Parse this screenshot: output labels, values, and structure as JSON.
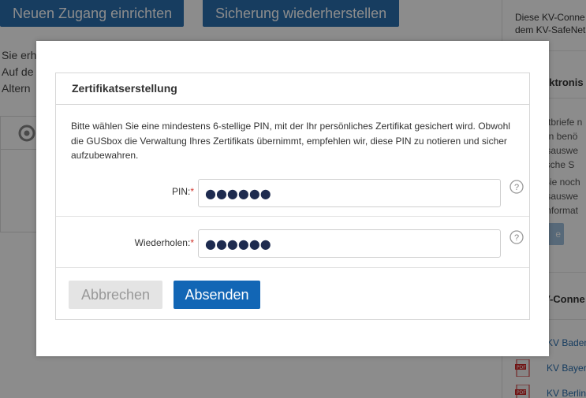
{
  "background": {
    "top_buttons": [
      "Neuen Zugang einrichten",
      "Sicherung wiederherstellen"
    ],
    "left_text_lines": [
      "Sie erh",
      "Auf de",
      "Altern"
    ],
    "sidebar": {
      "intro_lines": [
        "Diese KV-Conne",
        "dem KV-SafeNet"
      ],
      "heading_1": "ektronis",
      "lines_1": [
        "ztbriefe n",
        "en benö",
        "fsauswe",
        "ische S"
      ],
      "lines_2": [
        "Sie noch",
        "fsauswe",
        "Informat"
      ],
      "mini_button": "e",
      "heading_2": "V-Conne",
      "pdf_items": [
        "KV Baden",
        "KV Bayer",
        "KV Berlin"
      ],
      "pdf_badge": "PDF"
    }
  },
  "modal": {
    "panel_title": "Zertifikatserstellung",
    "description": "Bitte wählen Sie eine mindestens 6-stellige PIN, mit der Ihr persönliches Zertifikat gesichert wird. Obwohl die GUSbox die Verwaltung Ihres Zertifikats übernimmt, empfehlen wir, diese PIN zu notieren und sicher aufzubewahren.",
    "fields": [
      {
        "label": "PIN:",
        "required_mark": "*",
        "value": "●●●●●●",
        "help_icon": "?"
      },
      {
        "label": "Wiederholen:",
        "required_mark": "*",
        "value": "●●●●●●",
        "help_icon": "?"
      }
    ],
    "buttons": {
      "cancel": "Abbrechen",
      "submit": "Absenden"
    }
  },
  "colors": {
    "primary": "#1266b5",
    "required": "#d0332b",
    "disabled_bg": "#e4e4e4"
  }
}
